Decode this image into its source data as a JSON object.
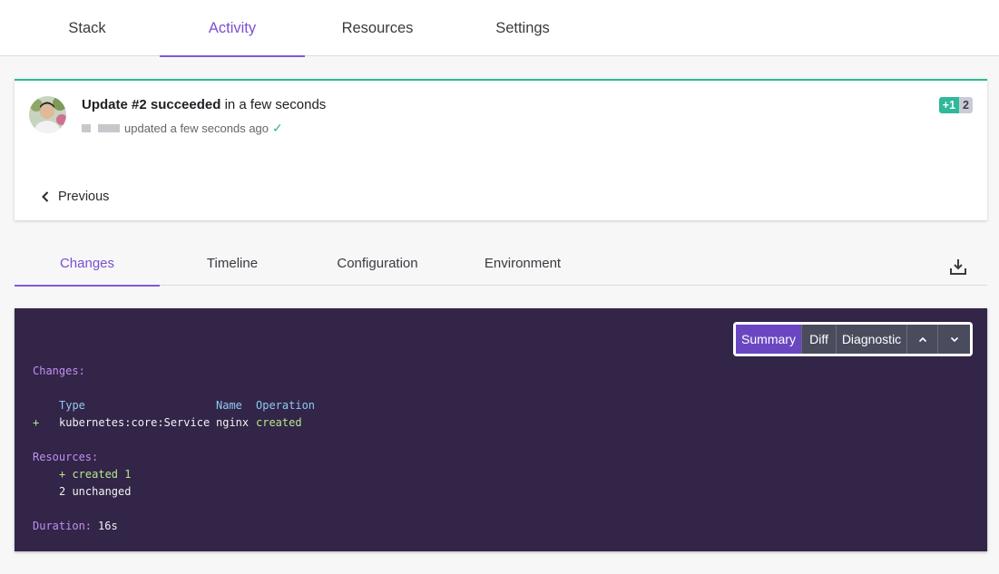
{
  "topnav": {
    "tabs": [
      {
        "label": "Stack"
      },
      {
        "label": "Activity"
      },
      {
        "label": "Resources"
      },
      {
        "label": "Settings"
      }
    ],
    "active": "Activity"
  },
  "update": {
    "title_bold": "Update #2 succeeded",
    "title_rest": " in a few seconds",
    "meta_text": "updated a few seconds ago",
    "badge_added": "+1",
    "badge_count": "2",
    "previous_label": "Previous"
  },
  "subtabs": {
    "tabs": [
      {
        "label": "Changes"
      },
      {
        "label": "Timeline"
      },
      {
        "label": "Configuration"
      },
      {
        "label": "Environment"
      }
    ],
    "active": "Changes",
    "download_icon": "download-icon"
  },
  "console": {
    "toolbar": {
      "summary": "Summary",
      "diff": "Diff",
      "diagnostic": "Diagnostic",
      "up_icon": "chevron-up-icon",
      "down_icon": "chevron-down-icon"
    },
    "changes_header": "Changes:",
    "col_type": "Type",
    "col_name": "Name",
    "col_operation": "Operation",
    "row": {
      "marker": "+",
      "type": "kubernetes:core:Service",
      "name": "nginx",
      "operation": "created"
    },
    "resources_header": "Resources:",
    "created_line": "+ created 1",
    "unchanged_line": "2 unchanged",
    "duration_label": "Duration:",
    "duration_value": "16s"
  },
  "colors": {
    "accent": "#805ad5",
    "success": "#2fb89a",
    "console_bg": "#322548"
  }
}
